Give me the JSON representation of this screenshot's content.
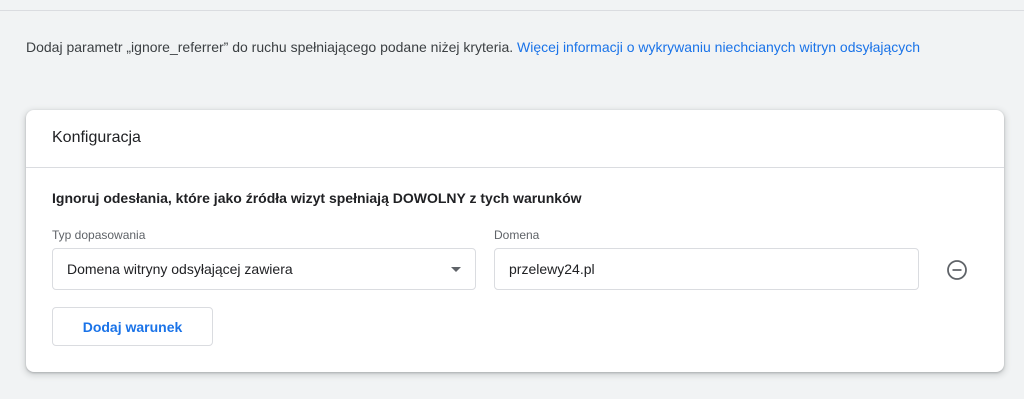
{
  "intro": {
    "text": "Dodaj parametr „ignore_referrer” do ruchu spełniającego podane niżej kryteria.",
    "link": "Więcej informacji o wykrywaniu niechcianych witryn odsyłających"
  },
  "card": {
    "title": "Konfiguracja",
    "section_title": "Ignoruj odesłania, które jako źródła wizyt spełniają DOWOLNY z tych warunków",
    "match_type": {
      "label": "Typ dopasowania",
      "value": "Domena witryny odsyłającej zawiera"
    },
    "domain": {
      "label": "Domena",
      "value": "przelewy24.pl"
    },
    "add_condition_label": "Dodaj warunek"
  },
  "icons": {
    "remove": "minus-circle-icon",
    "dropdown": "caret-down-icon"
  },
  "colors": {
    "accent": "#1a73e8",
    "background": "#f1f3f4",
    "border": "#dadce0"
  }
}
